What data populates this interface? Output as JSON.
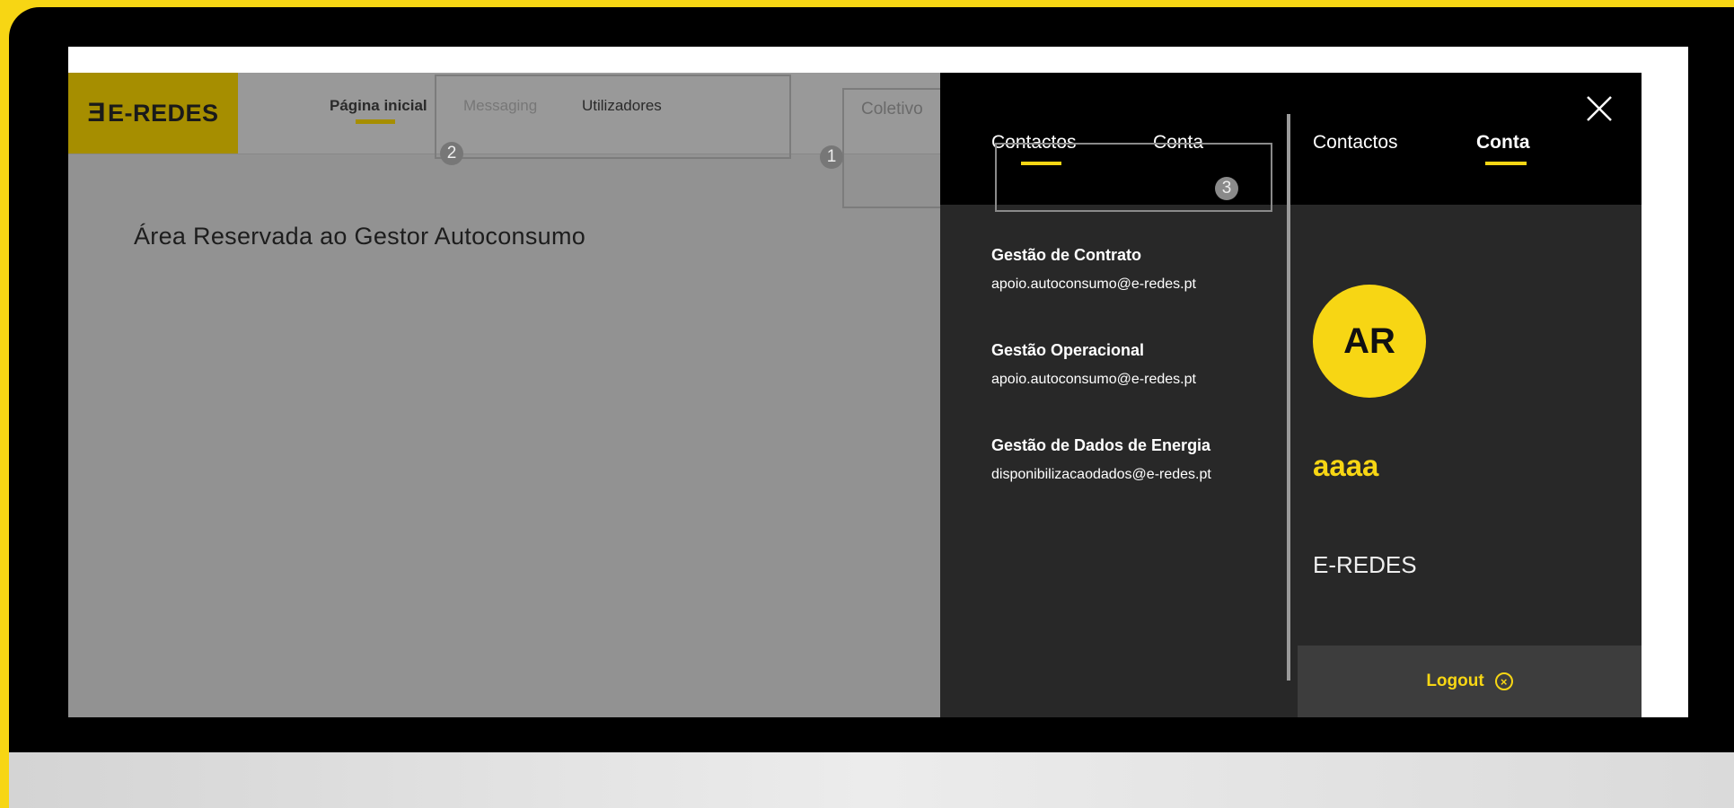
{
  "app": {
    "logo_text": "E-REDES",
    "logo_glyph": "Ǝ"
  },
  "nav": {
    "home": "Página inicial",
    "messaging": "Messaging",
    "users": "Utilizadores",
    "truncated_item": "Coletivo"
  },
  "page": {
    "title": "Área Reservada ao Gestor Autoconsumo"
  },
  "annotations": {
    "badge1": "1",
    "badge2": "2",
    "badge3": "3"
  },
  "panel": {
    "tabs_left": {
      "contacts": "Contactos",
      "account": "Conta"
    },
    "tabs_right": {
      "contacts": "Contactos",
      "account": "Conta"
    },
    "contacts": [
      {
        "heading": "Gestão de Contrato",
        "email": "apoio.autoconsumo@e-redes.pt"
      },
      {
        "heading": "Gestão Operacional",
        "email": "apoio.autoconsumo@e-redes.pt"
      },
      {
        "heading": "Gestão de Dados de Energia",
        "email": "disponibilizacaodados@e-redes.pt"
      }
    ],
    "account": {
      "initials": "AR",
      "name": "aaaa",
      "organization": "E-REDES"
    },
    "logout_label": "Logout"
  },
  "colors": {
    "accent": "#f7d614",
    "panel_dark": "#282828",
    "overlay_gray": "#929292"
  },
  "icons": {
    "close": "close-icon",
    "logout": "logout-circle-x-icon"
  }
}
